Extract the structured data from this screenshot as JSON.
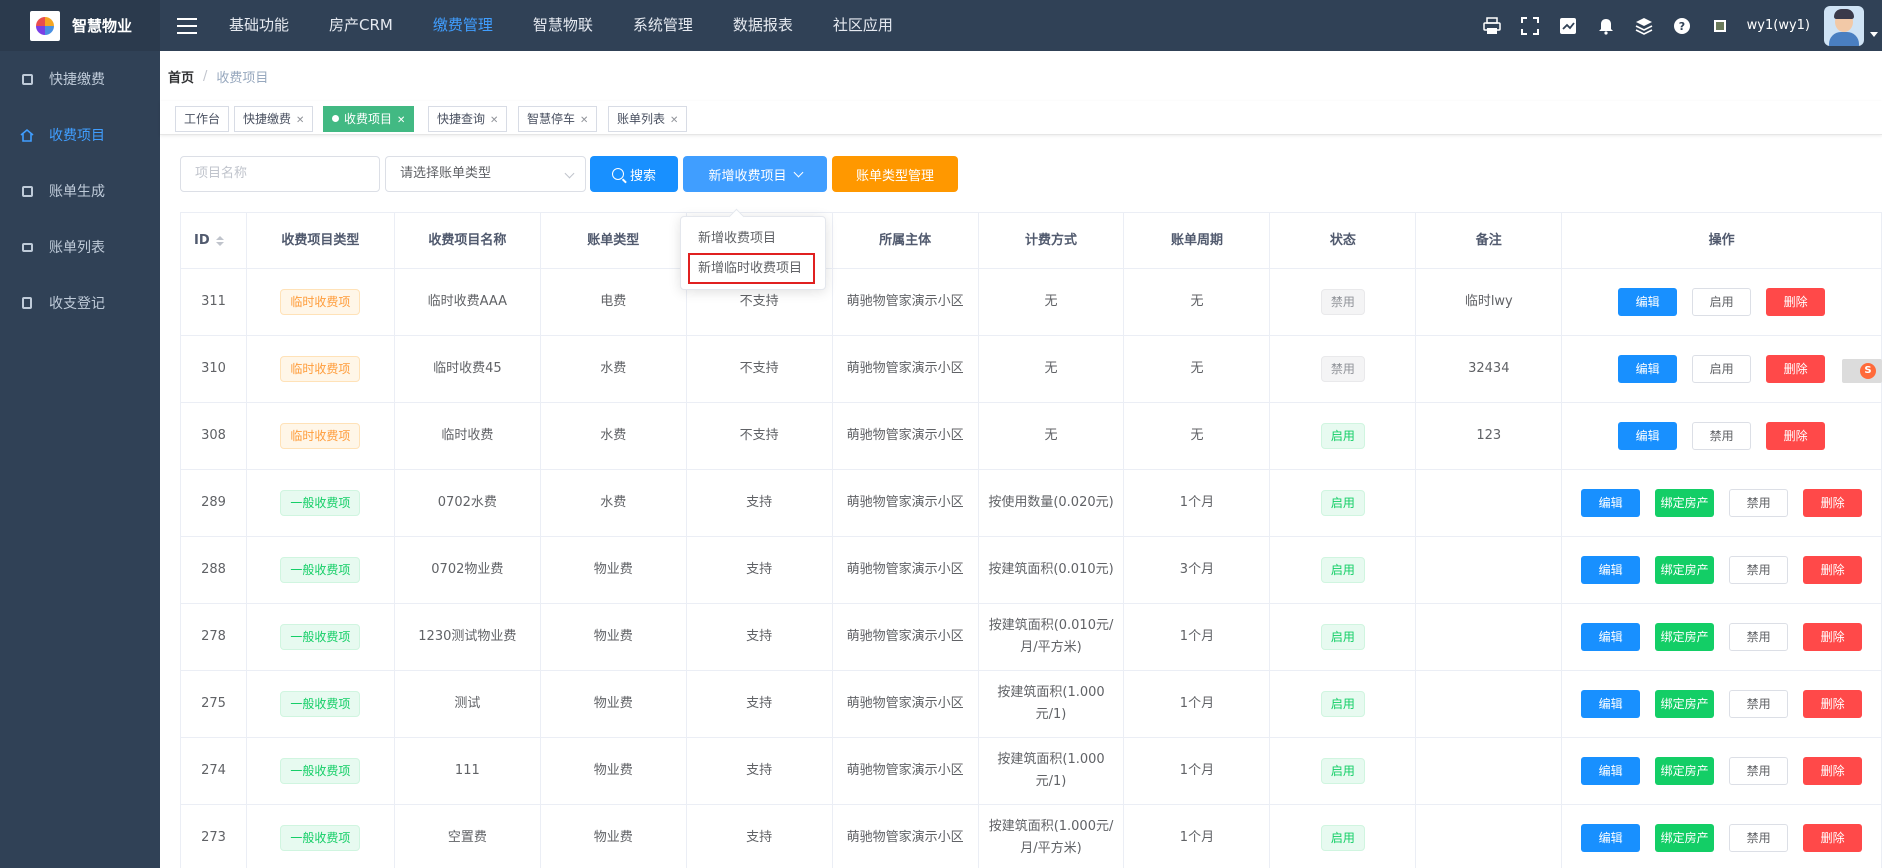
{
  "app": {
    "title": "智慧物业"
  },
  "topnav": [
    "基础功能",
    "房产CRM",
    "缴费管理",
    "智慧物联",
    "系统管理",
    "数据报表",
    "社区应用"
  ],
  "user": {
    "name": "wy1(wy1)"
  },
  "sidebar": [
    "快捷缴费",
    "收费项目",
    "账单生成",
    "账单列表",
    "收支登记"
  ],
  "breadcrumb": {
    "home": "首页",
    "current": "收费项目"
  },
  "tags": [
    "工作台",
    "快捷缴费",
    "收费项目",
    "快捷查询",
    "智慧停车",
    "账单列表"
  ],
  "filters": {
    "name_placeholder": "项目名称",
    "type_placeholder": "请选择账单类型",
    "search": "搜索",
    "add": "新增收费项目",
    "manage": "账单类型管理"
  },
  "dropdown": [
    "新增收费项目",
    "新增临时收费项目"
  ],
  "table": {
    "headers": [
      "ID",
      "收费项目类型",
      "收费项目名称",
      "账单类型",
      "",
      "所属主体",
      "计费方式",
      "账单周期",
      "状态",
      "备注",
      "操作"
    ],
    "rows": [
      {
        "id": "311",
        "type": "临时收费项",
        "name": "临时收费AAA",
        "bill": "电费",
        "split": "不支持",
        "owner": "萌驰物管家演示小区",
        "method": "无",
        "cycle": "无",
        "status": "禁用",
        "note": "临时lwy",
        "toggle": "启用"
      },
      {
        "id": "310",
        "type": "临时收费项",
        "name": "临时收费45",
        "bill": "水费",
        "split": "不支持",
        "owner": "萌驰物管家演示小区",
        "method": "无",
        "cycle": "无",
        "status": "禁用",
        "note": "32434",
        "toggle": "启用"
      },
      {
        "id": "308",
        "type": "临时收费项",
        "name": "临时收费",
        "bill": "水费",
        "split": "不支持",
        "owner": "萌驰物管家演示小区",
        "method": "无",
        "cycle": "无",
        "status": "启用",
        "note": "123",
        "toggle": "禁用"
      },
      {
        "id": "289",
        "type": "一般收费项",
        "name": "0702水费",
        "bill": "水费",
        "split": "支持",
        "owner": "萌驰物管家演示小区",
        "method": "按使用数量(0.020元)",
        "cycle": "1个月",
        "status": "启用",
        "note": "",
        "toggle": "禁用"
      },
      {
        "id": "288",
        "type": "一般收费项",
        "name": "0702物业费",
        "bill": "物业费",
        "split": "支持",
        "owner": "萌驰物管家演示小区",
        "method": "按建筑面积(0.010元)",
        "cycle": "3个月",
        "status": "启用",
        "note": "",
        "toggle": "禁用"
      },
      {
        "id": "278",
        "type": "一般收费项",
        "name": "1230测试物业费",
        "bill": "物业费",
        "split": "支持",
        "owner": "萌驰物管家演示小区",
        "method": "按建筑面积(0.010元/月/平方米)",
        "cycle": "1个月",
        "status": "启用",
        "note": "",
        "toggle": "禁用"
      },
      {
        "id": "275",
        "type": "一般收费项",
        "name": "测试",
        "bill": "物业费",
        "split": "支持",
        "owner": "萌驰物管家演示小区",
        "method": "按建筑面积(1.000元/1)",
        "cycle": "1个月",
        "status": "启用",
        "note": "",
        "toggle": "禁用"
      },
      {
        "id": "274",
        "type": "一般收费项",
        "name": "111",
        "bill": "物业费",
        "split": "支持",
        "owner": "萌驰物管家演示小区",
        "method": "按建筑面积(1.000元/1)",
        "cycle": "1个月",
        "status": "启用",
        "note": "",
        "toggle": "禁用"
      },
      {
        "id": "273",
        "type": "一般收费项",
        "name": "空置费",
        "bill": "物业费",
        "split": "支持",
        "owner": "萌驰物管家演示小区",
        "method": "按建筑面积(1.000元/月/平方米)",
        "cycle": "1个月",
        "status": "启用",
        "note": "",
        "toggle": "禁用"
      }
    ],
    "ops": {
      "edit": "编辑",
      "bind": "绑定房产",
      "delete": "删除"
    }
  },
  "colors": {
    "sidebar": "#304156",
    "accent": "#409eff",
    "active_tag": "#42b983"
  }
}
